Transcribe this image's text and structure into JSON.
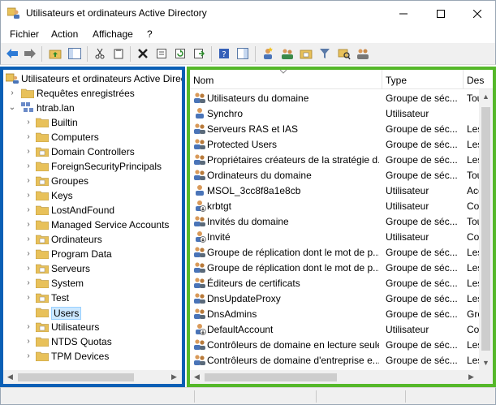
{
  "window": {
    "title": "Utilisateurs et ordinateurs Active Directory",
    "minimize_label": "—",
    "maximize_label": "☐",
    "close_label": "✕"
  },
  "menu": [
    "Fichier",
    "Action",
    "Affichage",
    "?"
  ],
  "tree": {
    "root_label": "Utilisateurs et ordinateurs Active Direct",
    "saved_queries": "Requêtes enregistrées",
    "domain": "htrab.lan",
    "children": [
      "Builtin",
      "Computers",
      "Domain Controllers",
      "ForeignSecurityPrincipals",
      "Groupes",
      "Keys",
      "LostAndFound",
      "Managed Service Accounts",
      "Ordinateurs",
      "Program Data",
      "Serveurs",
      "System",
      "Test",
      "Users",
      "Utilisateurs",
      "NTDS Quotas",
      "TPM Devices"
    ],
    "selected": "Users"
  },
  "list": {
    "columns": [
      "Nom",
      "Type",
      "Des"
    ],
    "rows": [
      {
        "name": "Utilisateurs du domaine",
        "type": "Groupe de séc...",
        "desc": "Tou",
        "kind": "group"
      },
      {
        "name": "Synchro",
        "type": "Utilisateur",
        "desc": "",
        "kind": "user"
      },
      {
        "name": "Serveurs RAS et IAS",
        "type": "Groupe de séc...",
        "desc": "Les",
        "kind": "group"
      },
      {
        "name": "Protected Users",
        "type": "Groupe de séc...",
        "desc": "Les",
        "kind": "group"
      },
      {
        "name": "Propriétaires créateurs de la stratégie d...",
        "type": "Groupe de séc...",
        "desc": "Les",
        "kind": "group"
      },
      {
        "name": "Ordinateurs du domaine",
        "type": "Groupe de séc...",
        "desc": "Tou",
        "kind": "group"
      },
      {
        "name": "MSOL_3cc8f8a1e8cb",
        "type": "Utilisateur",
        "desc": "Acc",
        "kind": "user"
      },
      {
        "name": "krbtgt",
        "type": "Utilisateur",
        "desc": "Cor",
        "kind": "user-disabled"
      },
      {
        "name": "Invités du domaine",
        "type": "Groupe de séc...",
        "desc": "Tou",
        "kind": "group"
      },
      {
        "name": "Invité",
        "type": "Utilisateur",
        "desc": "Cor",
        "kind": "user-disabled"
      },
      {
        "name": "Groupe de réplication dont le mot de p...",
        "type": "Groupe de séc...",
        "desc": "Les",
        "kind": "group"
      },
      {
        "name": "Groupe de réplication dont le mot de p...",
        "type": "Groupe de séc...",
        "desc": "Les",
        "kind": "group"
      },
      {
        "name": "Éditeurs de certificats",
        "type": "Groupe de séc...",
        "desc": "Les",
        "kind": "group"
      },
      {
        "name": "DnsUpdateProxy",
        "type": "Groupe de séc...",
        "desc": "Les",
        "kind": "group"
      },
      {
        "name": "DnsAdmins",
        "type": "Groupe de séc...",
        "desc": "Gro",
        "kind": "group"
      },
      {
        "name": "DefaultAccount",
        "type": "Utilisateur",
        "desc": "Cor",
        "kind": "user-disabled"
      },
      {
        "name": "Contrôleurs de domaine en lecture seule",
        "type": "Groupe de séc...",
        "desc": "Les",
        "kind": "group"
      },
      {
        "name": "Contrôleurs de domaine d'entreprise e...",
        "type": "Groupe de séc...",
        "desc": "Les",
        "kind": "group"
      }
    ]
  },
  "colors": {
    "left_pane_border": "#0a5fb5",
    "right_pane_border": "#55b82a",
    "selection": "#cce8ff",
    "folder": "#e8c15a"
  }
}
